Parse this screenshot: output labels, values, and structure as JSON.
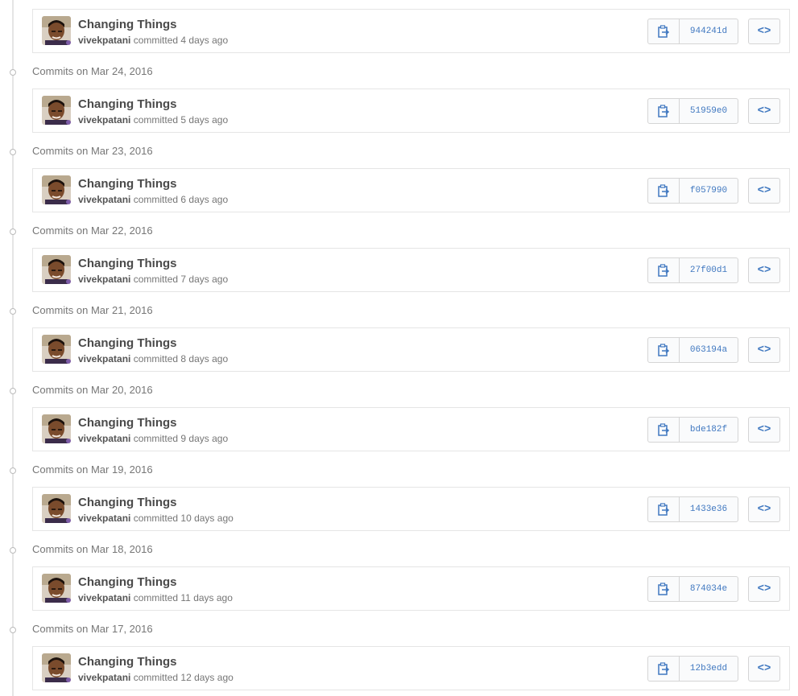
{
  "commits": [
    {
      "title": "Changing Things",
      "author": "vivekpatani",
      "when": "committed 4 days ago",
      "sha": "944241d",
      "date_header": ""
    },
    {
      "title": "Changing Things",
      "author": "vivekpatani",
      "when": "committed 5 days ago",
      "sha": "51959e0",
      "date_header": "on Mar 24, 2016"
    },
    {
      "title": "Changing Things",
      "author": "vivekpatani",
      "when": "committed 6 days ago",
      "sha": "f057990",
      "date_header": "on Mar 23, 2016"
    },
    {
      "title": "Changing Things",
      "author": "vivekpatani",
      "when": "committed 7 days ago",
      "sha": "27f00d1",
      "date_header": "on Mar 22, 2016"
    },
    {
      "title": "Changing Things",
      "author": "vivekpatani",
      "when": "committed 8 days ago",
      "sha": "063194a",
      "date_header": "on Mar 21, 2016"
    },
    {
      "title": "Changing Things",
      "author": "vivekpatani",
      "when": "committed 9 days ago",
      "sha": "bde182f",
      "date_header": "on Mar 20, 2016"
    },
    {
      "title": "Changing Things",
      "author": "vivekpatani",
      "when": "committed 10 days ago",
      "sha": "1433e36",
      "date_header": "on Mar 19, 2016"
    },
    {
      "title": "Changing Things",
      "author": "vivekpatani",
      "when": "committed 11 days ago",
      "sha": "874034e",
      "date_header": "on Mar 18, 2016"
    },
    {
      "title": "Changing Things",
      "author": "vivekpatani",
      "when": "committed 12 days ago",
      "sha": "12b3edd",
      "date_header": "on Mar 17, 2016"
    }
  ],
  "labels": {
    "commits_prefix": "Commits",
    "browse": "<>"
  },
  "icons": {
    "copy": "clipboard-icon",
    "browse": "code-icon",
    "avatar": "avatar"
  },
  "colors": {
    "link": "#4078c0",
    "border": "#e5e5e5",
    "muted": "#767676"
  }
}
